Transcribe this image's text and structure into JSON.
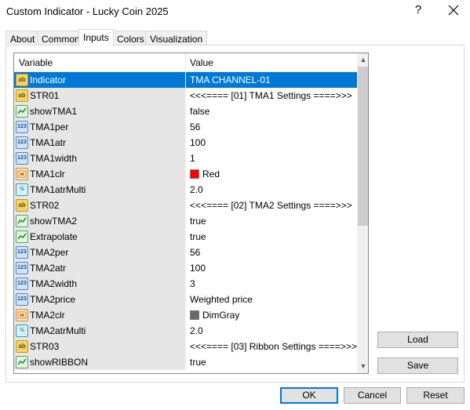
{
  "window": {
    "title": "Custom Indicator - Lucky Coin 2025",
    "help_label": "?"
  },
  "tabs": [
    {
      "label": "About",
      "active": false
    },
    {
      "label": "Common",
      "active": false
    },
    {
      "label": "Inputs",
      "active": true
    },
    {
      "label": "Colors",
      "active": false
    },
    {
      "label": "Visualization",
      "active": false
    }
  ],
  "grid": {
    "headers": {
      "variable": "Variable",
      "value": "Value"
    },
    "rows": [
      {
        "icon": "ab",
        "name": "Indicator",
        "value": "TMA CHANNEL-01",
        "selected": true
      },
      {
        "icon": "ab",
        "name": "STR01",
        "value": "<<<==== [01] TMA1 Settings ====>>>"
      },
      {
        "icon": "bool",
        "name": "showTMA1",
        "value": "false"
      },
      {
        "icon": "123",
        "name": "TMA1per",
        "value": "56"
      },
      {
        "icon": "123",
        "name": "TMA1atr",
        "value": "100"
      },
      {
        "icon": "123",
        "name": "TMA1width",
        "value": "1"
      },
      {
        "icon": "color",
        "name": "TMA1clr",
        "value": "Red",
        "swatch": "#ff0000"
      },
      {
        "icon": "dbl",
        "name": "TMA1atrMulti",
        "value": "2.0"
      },
      {
        "icon": "ab",
        "name": "STR02",
        "value": "<<<==== [02] TMA2 Settings ====>>>"
      },
      {
        "icon": "bool",
        "name": "showTMA2",
        "value": "true"
      },
      {
        "icon": "bool",
        "name": "Extrapolate",
        "value": "true"
      },
      {
        "icon": "123",
        "name": "TMA2per",
        "value": "56"
      },
      {
        "icon": "123",
        "name": "TMA2atr",
        "value": "100"
      },
      {
        "icon": "123",
        "name": "TMA2width",
        "value": "3"
      },
      {
        "icon": "123",
        "name": "TMA2price",
        "value": "Weighted price"
      },
      {
        "icon": "color",
        "name": "TMA2clr",
        "value": "DimGray",
        "swatch": "#696969"
      },
      {
        "icon": "dbl",
        "name": "TMA2atrMulti",
        "value": "2.0"
      },
      {
        "icon": "ab",
        "name": "STR03",
        "value": "<<<==== [03] Ribbon Settings ====>>>"
      },
      {
        "icon": "bool",
        "name": "showRIBBON",
        "value": "true"
      }
    ]
  },
  "side_buttons": {
    "load": "Load",
    "save": "Save"
  },
  "footer": {
    "ok": "OK",
    "cancel": "Cancel",
    "reset": "Reset"
  },
  "colors": {
    "selection": "#0078d7",
    "accent_border": "#0078d7"
  }
}
